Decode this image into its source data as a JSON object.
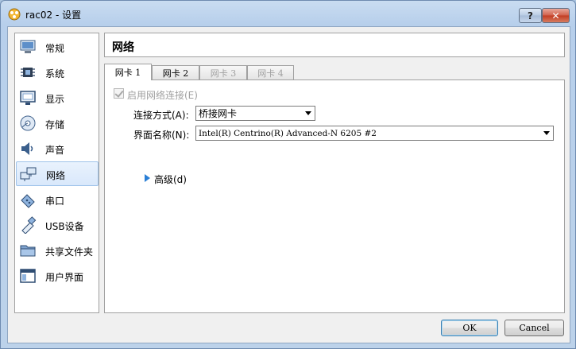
{
  "window": {
    "title": "rac02 - 设置"
  },
  "sidebar": {
    "items": [
      {
        "label": "常规",
        "icon": "monitor-icon"
      },
      {
        "label": "系统",
        "icon": "chip-icon"
      },
      {
        "label": "显示",
        "icon": "display-icon"
      },
      {
        "label": "存储",
        "icon": "disk-icon"
      },
      {
        "label": "声音",
        "icon": "speaker-icon"
      },
      {
        "label": "网络",
        "icon": "network-icon"
      },
      {
        "label": "串口",
        "icon": "serial-port-icon"
      },
      {
        "label": "USB设备",
        "icon": "usb-icon"
      },
      {
        "label": "共享文件夹",
        "icon": "folder-icon"
      },
      {
        "label": "用户界面",
        "icon": "window-icon"
      }
    ],
    "selected": "网络"
  },
  "main": {
    "header": "网络",
    "tabs": [
      {
        "label": "网卡 1",
        "state": "active"
      },
      {
        "label": "网卡 2",
        "state": "enabled"
      },
      {
        "label": "网卡 3",
        "state": "disabled"
      },
      {
        "label": "网卡 4",
        "state": "disabled"
      }
    ],
    "enable_checkbox_label": "启用网络连接(E)",
    "attached_label": "连接方式(A):",
    "attached_value": "桥接网卡",
    "name_label": "界面名称(N):",
    "name_value": "Intel(R) Centrino(R) Advanced-N 6205 #2",
    "advanced_label": "高级(d)"
  },
  "buttons": {
    "ok": "OK",
    "cancel": "Cancel"
  },
  "colors": {
    "selection": "#d9e8fb",
    "accent": "#2a7fd6",
    "close": "#c23b22"
  }
}
